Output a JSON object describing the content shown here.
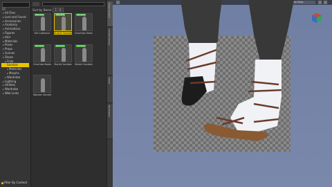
{
  "categories": [
    {
      "label": "All Files",
      "depth": 0,
      "selected": false
    },
    {
      "label": "Lost and Found",
      "depth": 0,
      "selected": false
    },
    {
      "label": "Accessories",
      "depth": 0,
      "selected": false
    },
    {
      "label": "Anatomy",
      "depth": 0,
      "selected": false
    },
    {
      "label": "Animations",
      "depth": 0,
      "selected": false
    },
    {
      "label": "Figures",
      "depth": 0,
      "selected": false
    },
    {
      "label": "Hair",
      "depth": 0,
      "selected": false
    },
    {
      "label": "Materials",
      "depth": 0,
      "selected": false
    },
    {
      "label": "Poses",
      "depth": 0,
      "selected": false
    },
    {
      "label": "Props",
      "depth": 0,
      "selected": false
    },
    {
      "label": "Scenes",
      "depth": 0,
      "selected": false
    },
    {
      "label": "Shoes",
      "depth": 0,
      "selected": false
    },
    {
      "label": "Flats",
      "depth": 1,
      "selected": false
    },
    {
      "label": "Sandals",
      "depth": 1,
      "selected": true
    },
    {
      "label": "Materials",
      "depth": 2,
      "selected": false
    },
    {
      "label": "Morphs",
      "depth": 2,
      "selected": false
    },
    {
      "label": "Wardrobe",
      "depth": 1,
      "selected": false
    },
    {
      "label": "Lighting",
      "depth": 0,
      "selected": false
    },
    {
      "label": "Utilities",
      "depth": 0,
      "selected": false
    },
    {
      "label": "Wardrobe",
      "depth": 0,
      "selected": false
    },
    {
      "label": "Web Links",
      "depth": 0,
      "selected": false
    }
  ],
  "footer": {
    "label": "Filter By Context"
  },
  "sortbar": {
    "label": "Sort by Name",
    "page": "1 - 6"
  },
  "items": [
    {
      "label": "Kiki Labienne",
      "badge": "Wearable",
      "selected": false
    },
    {
      "label": "Angele Sandals",
      "badge": "Wearable",
      "selected": true
    },
    {
      "label": "Chechias Heels 2",
      "badge": "Wearable",
      "selected": false
    },
    {
      "label": "Chechias Boots",
      "badge": "Wearable",
      "selected": false
    },
    {
      "label": "Marlet Sandals",
      "badge": "Wearable",
      "selected": false
    },
    {
      "label": "Medici Sandals",
      "badge": "Wearable",
      "selected": false
    },
    {
      "label": "Wonder Sandals Outfit",
      "badge": "",
      "selected": false
    }
  ],
  "vtabs": [
    "Smart Content",
    "Content Library",
    "Scene",
    "Parameters"
  ],
  "viewport": {
    "camera": "Perspective View"
  },
  "colors": {
    "accent": "#e8c400",
    "badge": "#3ab53a",
    "viewport": "#7382a6"
  }
}
